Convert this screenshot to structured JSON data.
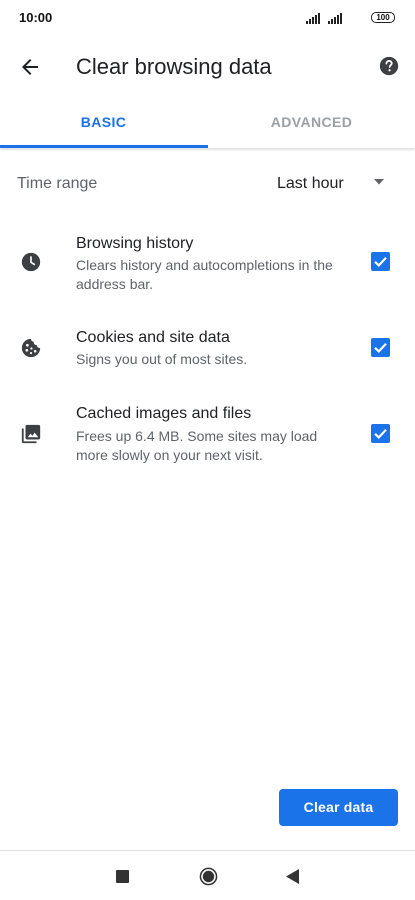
{
  "status_bar": {
    "time": "10:00",
    "battery": "100"
  },
  "app_bar": {
    "title": "Clear browsing data",
    "icons": [
      "back-arrow-icon",
      "help-icon"
    ]
  },
  "tabs": [
    {
      "label": "BASIC",
      "selected": true
    },
    {
      "label": "ADVANCED",
      "selected": false
    }
  ],
  "time_range": {
    "label": "Time range",
    "value": "Last hour"
  },
  "options": [
    {
      "icon": "clock-icon",
      "title": "Browsing history",
      "description": "Clears history and autocompletions in the address bar.",
      "checked": true
    },
    {
      "icon": "cookie-icon",
      "title": "Cookies and site data",
      "description": "Signs you out of most sites.",
      "checked": true
    },
    {
      "icon": "image-icon",
      "title": "Cached images and files",
      "description": "Frees up 6.4 MB. Some sites may load more slowly on your next visit.",
      "checked": true
    }
  ],
  "clear_button": {
    "label": "Clear data"
  },
  "colors": {
    "accent": "#1a73e8",
    "text_primary": "#202124",
    "text_secondary": "#5f6368",
    "tab_inactive": "#9aa0a6"
  }
}
